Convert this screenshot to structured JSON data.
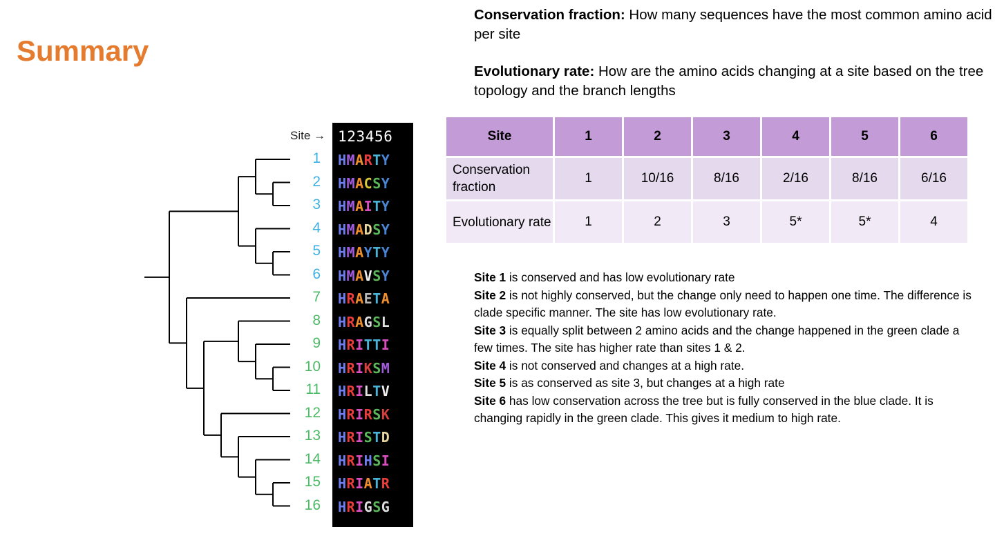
{
  "title": "Summary",
  "definitions": [
    {
      "term": "Conservation fraction:",
      "text": "How many sequences have the most common amino acid per site"
    },
    {
      "term": "Evolutionary rate:",
      "text": "How are the amino acids changing at a site based on the tree topology and the branch lengths"
    }
  ],
  "alignment": {
    "site_label": "Site →",
    "header": "123456",
    "clade_colors": {
      "blue": "#3fb0e3",
      "green": "#4cb966"
    },
    "residue_colors": {
      "H": "#6f7ff0",
      "M": "#a35be0",
      "R": "#ec3d3d",
      "A": "#ef8f2c",
      "C": "#d9c83a",
      "S": "#5bb85a",
      "Y": "#4a84d4",
      "T": "#4ab4d8",
      "I": "#d84fbf",
      "D": "#e8d8a0",
      "V": "#f0f0f0",
      "E": "#b8b8b8",
      "G": "#dddddd",
      "L": "#e0e0e0",
      "K": "#d84040",
      "N": "#a0a0a0",
      "Q": "#a0a0a0"
    },
    "sequences": [
      {
        "id": "1",
        "clade": "blue",
        "seq": "HMARTY"
      },
      {
        "id": "2",
        "clade": "blue",
        "seq": "HMACSY"
      },
      {
        "id": "3",
        "clade": "blue",
        "seq": "HMAITY"
      },
      {
        "id": "4",
        "clade": "blue",
        "seq": "HMADSY"
      },
      {
        "id": "5",
        "clade": "blue",
        "seq": "HMAYTY"
      },
      {
        "id": "6",
        "clade": "blue",
        "seq": "HMAVSY"
      },
      {
        "id": "7",
        "clade": "green",
        "seq": "HRAETA"
      },
      {
        "id": "8",
        "clade": "green",
        "seq": "HRAGSL"
      },
      {
        "id": "9",
        "clade": "green",
        "seq": "HRITTI"
      },
      {
        "id": "10",
        "clade": "green",
        "seq": "HRIKSM"
      },
      {
        "id": "11",
        "clade": "green",
        "seq": "HRILTV"
      },
      {
        "id": "12",
        "clade": "green",
        "seq": "HRIRSK"
      },
      {
        "id": "13",
        "clade": "green",
        "seq": "HRISTD"
      },
      {
        "id": "14",
        "clade": "green",
        "seq": "HRIHSI"
      },
      {
        "id": "15",
        "clade": "green",
        "seq": "HRIATR"
      },
      {
        "id": "16",
        "clade": "green",
        "seq": "HRIGSG"
      }
    ],
    "tree_newick": "((((1,(2,3)),(4,(5,6)))),(7,((8,(9,(10,11))),(12,(13,(14,(15,16)))))));"
  },
  "table": {
    "header": [
      "Site",
      "1",
      "2",
      "3",
      "4",
      "5",
      "6"
    ],
    "rows": [
      {
        "label": "Conservation fraction",
        "values": [
          "1",
          "10/16",
          "8/16",
          "2/16",
          "8/16",
          "6/16"
        ]
      },
      {
        "label": "Evolutionary rate",
        "values": [
          "1",
          "2",
          "3",
          "5*",
          "5*",
          "4"
        ]
      }
    ]
  },
  "notes": [
    {
      "term": "Site 1",
      "text": " is conserved and has low evolutionary rate"
    },
    {
      "term": "Site 2",
      "text": " is not highly conserved, but the change only need to happen one time. The difference is clade specific manner. The site has low evolutionary rate."
    },
    {
      "term": "Site 3",
      "text": " is equally split between 2 amino acids and the change happened in the green clade a few times. The site has higher rate than sites 1 & 2."
    },
    {
      "term": "Site 4",
      "text": " is not conserved and changes at a high rate."
    },
    {
      "term": "Site 5",
      "text": " is as conserved as site 3, but changes at a high rate"
    },
    {
      "term": "Site 6",
      "text": " has low conservation across the tree but is fully conserved in the blue clade. It is changing rapidly in the green clade. This gives it medium to high rate."
    }
  ]
}
